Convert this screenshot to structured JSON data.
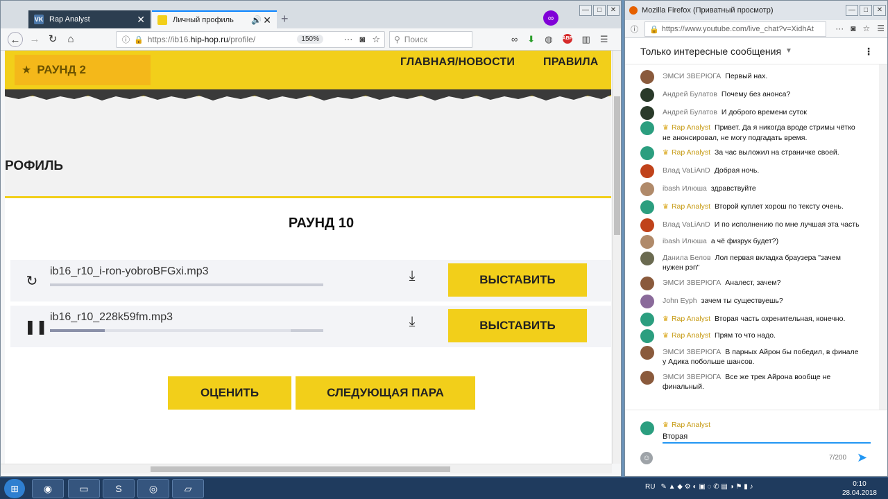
{
  "left_browser": {
    "tabs": [
      {
        "label": "Rap Analyst",
        "close": "✕"
      },
      {
        "label": "Личный профиль",
        "close": "✕"
      }
    ],
    "new_tab": "+",
    "url_host_prefix": "https://ib16.",
    "url_host": "hip-hop.ru",
    "url_path": "/profile/",
    "zoom": "150%",
    "search_placeholder": "Поиск",
    "window_buttons": [
      "—",
      "□",
      "✕"
    ]
  },
  "site": {
    "round_badge": "РАУНД 2",
    "nav": {
      "home": "ГЛАВНАЯ/НОВОСТИ",
      "rules": "ПРАВИЛА"
    },
    "profile_title": "РОФИЛЬ",
    "round_heading": "РАУНД 10",
    "tracks": [
      {
        "filename": "ib16_r10_i-ron-yobroBFGxi.mp3",
        "state_icon": "reload-icon",
        "progress": 0,
        "button": "ВЫСТАВИТЬ"
      },
      {
        "filename": "ib16_r10_228k59fm.mp3",
        "state_icon": "pause-icon",
        "progress": 0.2,
        "buffered": 0.88,
        "button": "ВЫСТАВИТЬ"
      }
    ],
    "rate_button": "ОЦЕНИТЬ",
    "next_pair_button": "СЛЕДУЮЩАЯ ПАРА"
  },
  "right_browser": {
    "title": "Mozilla Firefox (Приватный просмотр)",
    "url": "https://www.youtube.com/live_chat?v=XidhAt",
    "window_buttons": [
      "—",
      "□",
      "✕"
    ],
    "chat_filter": "Только интересные сообщения",
    "messages": [
      {
        "author": "ЭМСИ ЗВЕРЮГА",
        "text": "Первый нах.",
        "owner": false,
        "avatar_color": "#8a5a3c"
      },
      {
        "author": "Андрей Булатов",
        "text": "Почему без анонса?",
        "owner": false,
        "avatar_color": "#2a3a2a"
      },
      {
        "author": "Андрей Булатов",
        "text": "И доброго времени суток",
        "owner": false,
        "avatar_color": "#2a3a2a"
      },
      {
        "author": "Rap Analyst",
        "text": "Привет. Да я никогда вроде стримы чётко не анонсировал, не могу подгадать время.",
        "owner": true,
        "avatar_color": "#2b9e7f"
      },
      {
        "author": "Rap Analyst",
        "text": "За час выложил на страничке своей.",
        "owner": true,
        "avatar_color": "#2b9e7f"
      },
      {
        "author": "Влад VaLiAnD",
        "text": "Добрая ночь.",
        "owner": false,
        "avatar_color": "#c0421a"
      },
      {
        "author": "ibash Илюша",
        "text": "здравствуйте",
        "owner": false,
        "avatar_color": "#b08a6a"
      },
      {
        "author": "Rap Analyst",
        "text": "Второй куплет хорош по тексту очень.",
        "owner": true,
        "avatar_color": "#2b9e7f"
      },
      {
        "author": "Влад VaLiAnD",
        "text": "И по исполнению по мне лучшая эта часть",
        "owner": false,
        "avatar_color": "#c0421a"
      },
      {
        "author": "ibash Илюша",
        "text": "а чё физрук будет?)",
        "owner": false,
        "avatar_color": "#b08a6a"
      },
      {
        "author": "Данила Белов",
        "text": "Лол первая вкладка браузера \"зачем нужен рэп\"",
        "owner": false,
        "avatar_color": "#6a6a50"
      },
      {
        "author": "ЭМСИ ЗВЕРЮГА",
        "text": "Аналест, зачем?",
        "owner": false,
        "avatar_color": "#8a5a3c"
      },
      {
        "author": "John Eyph",
        "text": "зачем ты существуешь?",
        "owner": false,
        "avatar_color": "#8a6a9a"
      },
      {
        "author": "Rap Analyst",
        "text": "Вторая часть охренительная, конечно.",
        "owner": true,
        "avatar_color": "#2b9e7f"
      },
      {
        "author": "Rap Analyst",
        "text": "Прям то что надо.",
        "owner": true,
        "avatar_color": "#2b9e7f"
      },
      {
        "author": "ЭМСИ ЗВЕРЮГА",
        "text": "В парных Айрон бы победил, в финале у Адика побольше шансов.",
        "owner": false,
        "avatar_color": "#8a5a3c"
      },
      {
        "author": "ЭМСИ ЗВЕРЮГА",
        "text": "Все же трек Айрона вообще не финальный.",
        "owner": false,
        "avatar_color": "#8a5a3c"
      }
    ],
    "composer": {
      "author": "Rap Analyst",
      "value": "Вторая ",
      "counter": "7/200"
    }
  },
  "taskbar": {
    "lang": "RU",
    "time": "0:10",
    "date": "28.04.2018"
  },
  "colors": {
    "site_yellow": "#f2cf1a",
    "owner_gold": "#c69a12",
    "accent_blue": "#2196f3"
  }
}
